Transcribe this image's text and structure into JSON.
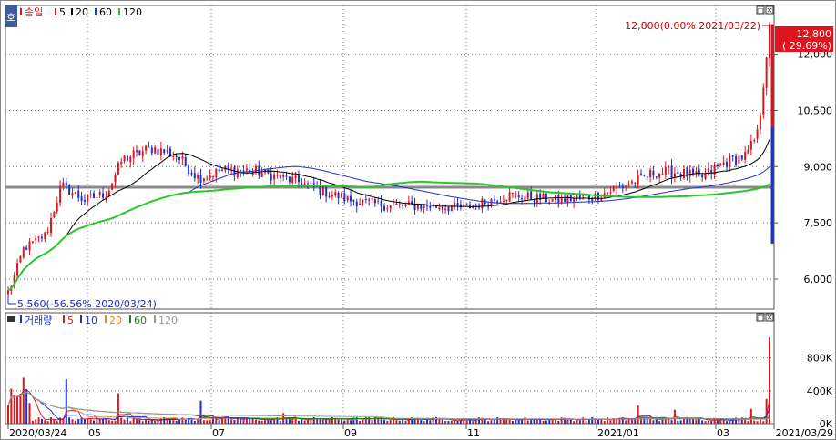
{
  "price_panel": {
    "legend": {
      "tag": "호",
      "title": "송일",
      "mas": [
        {
          "label": "5",
          "color": "#d11d1d"
        },
        {
          "label": "20",
          "color": "#000000"
        },
        {
          "label": "60",
          "color": "#1f31c9"
        },
        {
          "label": "120",
          "color": "#29c729"
        }
      ]
    },
    "high_annotation": "12,800(0.00% 2021/03/22)",
    "low_annotation": "5,560(-56.56% 2020/03/24)",
    "current_price_box": {
      "price": "12,800",
      "change": "( 29.69%)"
    },
    "y_ticks": [
      "12,000",
      "10,500",
      "9,000",
      "7,500",
      "6,000"
    ],
    "window_buttons": [
      "□",
      "×"
    ]
  },
  "volume_panel": {
    "legend": {
      "title": "거래량",
      "mas": [
        {
          "label": "5",
          "color": "#d11d1d"
        },
        {
          "label": "10",
          "color": "#1f31c9"
        },
        {
          "label": "20",
          "color": "#e0892b"
        },
        {
          "label": "60",
          "color": "#1f7a1f"
        },
        {
          "label": "120",
          "color": "#999999"
        }
      ]
    },
    "y_ticks": [
      "800K",
      "400K",
      "0K"
    ],
    "window_buttons": [
      "□",
      "×"
    ]
  },
  "x_axis": {
    "start_label": "2020/03/24",
    "end_label": "2021/03/29",
    "ticks": [
      "05",
      "07",
      "09",
      "11",
      "2021/01",
      "03"
    ]
  },
  "chart_data": {
    "type": "candlestick",
    "title": "송일",
    "date_range": [
      "2020/03/24",
      "2021/03/29"
    ],
    "price_ylim": [
      5200,
      13300
    ],
    "volume_ylim": [
      0,
      1150000
    ],
    "horizontal_line_price": 8450,
    "price_anchors": [
      {
        "t": 0.0,
        "p": 5600
      },
      {
        "t": 0.02,
        "p": 6800
      },
      {
        "t": 0.05,
        "p": 7200
      },
      {
        "t": 0.07,
        "p": 8500
      },
      {
        "t": 0.1,
        "p": 8100
      },
      {
        "t": 0.13,
        "p": 8300
      },
      {
        "t": 0.15,
        "p": 9200
      },
      {
        "t": 0.19,
        "p": 9500
      },
      {
        "t": 0.22,
        "p": 9300
      },
      {
        "t": 0.25,
        "p": 8700
      },
      {
        "t": 0.28,
        "p": 8900
      },
      {
        "t": 0.32,
        "p": 8900
      },
      {
        "t": 0.38,
        "p": 8600
      },
      {
        "t": 0.42,
        "p": 8300
      },
      {
        "t": 0.45,
        "p": 8100
      },
      {
        "t": 0.5,
        "p": 7950
      },
      {
        "t": 0.55,
        "p": 7950
      },
      {
        "t": 0.6,
        "p": 7900
      },
      {
        "t": 0.66,
        "p": 8250
      },
      {
        "t": 0.72,
        "p": 8100
      },
      {
        "t": 0.77,
        "p": 8200
      },
      {
        "t": 0.81,
        "p": 8500
      },
      {
        "t": 0.85,
        "p": 8850
      },
      {
        "t": 0.88,
        "p": 8850
      },
      {
        "t": 0.91,
        "p": 8700
      },
      {
        "t": 0.94,
        "p": 9100
      },
      {
        "t": 0.97,
        "p": 9300
      },
      {
        "t": 0.985,
        "p": 9900
      },
      {
        "t": 1.0,
        "p": 12800
      }
    ]
  }
}
